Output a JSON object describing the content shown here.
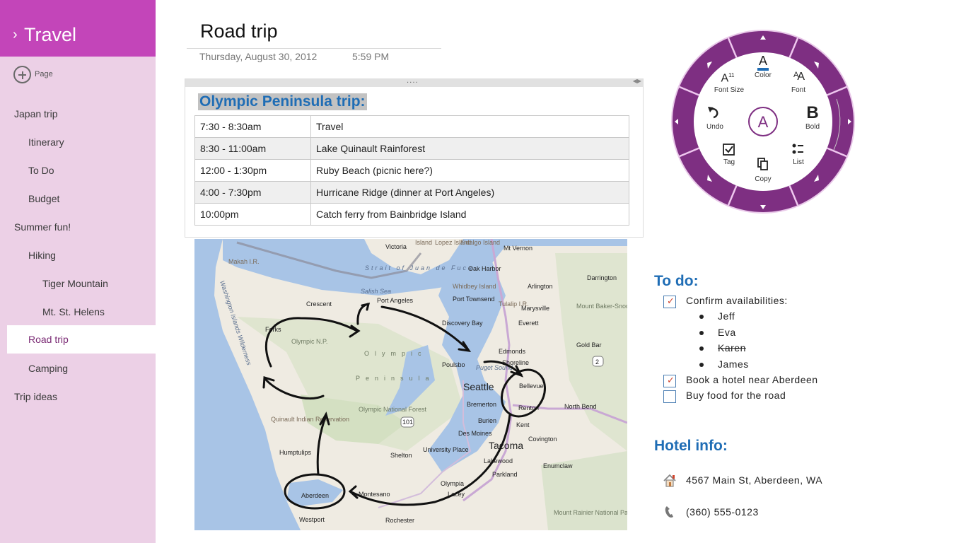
{
  "notebook": {
    "title": "Travel",
    "chevron_icon": "chevron-right-icon",
    "add_page_label": "Page"
  },
  "sidebar": {
    "pages": [
      {
        "label": "Japan trip",
        "level": 0,
        "selected": false
      },
      {
        "label": "Itinerary",
        "level": 1,
        "selected": false
      },
      {
        "label": "To Do",
        "level": 1,
        "selected": false
      },
      {
        "label": "Budget",
        "level": 1,
        "selected": false
      },
      {
        "label": "Summer fun!",
        "level": 0,
        "selected": false
      },
      {
        "label": "Hiking",
        "level": 1,
        "selected": false
      },
      {
        "label": "Tiger Mountain",
        "level": 2,
        "selected": false
      },
      {
        "label": "Mt. St. Helens",
        "level": 2,
        "selected": false
      },
      {
        "label": "Road trip",
        "level": 1,
        "selected": true
      },
      {
        "label": "Camping",
        "level": 1,
        "selected": false
      },
      {
        "label": "Trip ideas",
        "level": 0,
        "selected": false
      }
    ]
  },
  "page": {
    "title": "Road trip",
    "date": "Thursday, August 30, 2012",
    "time": "5:59 PM"
  },
  "note": {
    "grip": "....",
    "heading": "Olympic Peninsula trip:",
    "schedule": [
      {
        "time": "7:30 - 8:30am",
        "activity": "Travel"
      },
      {
        "time": "8:30 - 11:00am",
        "activity": "Lake Quinault Rainforest"
      },
      {
        "time": "12:00 - 1:30pm",
        "activity": "Ruby Beach (picnic here?)"
      },
      {
        "time": "4:00 - 7:30pm",
        "activity": "Hurricane Ridge (dinner at Port Angeles)"
      },
      {
        "time": "10:00pm",
        "activity": "Catch ferry from Bainbridge Island"
      }
    ]
  },
  "map": {
    "labels": {
      "victoria": "Victoria",
      "island": "Island",
      "lopez_island": "Lopez Island",
      "fidalgo_island": "Fidalgo Island",
      "mt_vernon": "Mt Vernon",
      "makah": "Makah I.R.",
      "strait": "Strait of Juan de Fuca",
      "oak_harbor": "Oak Harbor",
      "darrington": "Darrington",
      "whidbey": "Whidbey Island",
      "arlington": "Arlington",
      "salish_sea": "Salish Sea",
      "port_angeles": "Port Angeles",
      "port_townsend": "Port Townsend",
      "tulalip": "Tulalip I.R.",
      "marysville": "Marysville",
      "crescent": "Crescent",
      "mt_baker": "Mount Baker-Snoqualmie National Forest",
      "wilderness": "Washington Islands Wilderness",
      "discovery_bay": "Discovery Bay",
      "everett": "Everett",
      "forks": "Forks",
      "olympic_np": "Olympic N.P.",
      "gold_bar": "Gold Bar",
      "edmonds": "Edmonds",
      "olympic": "Olympic",
      "poulsbo": "Poulsbo",
      "shoreline": "Shoreline",
      "puget_sound": "Puget Sound",
      "hwy2": "2",
      "peninsula": "Peninsula",
      "seattle": "Seattle",
      "bellevue": "Bellevue",
      "bremerton": "Bremerton",
      "renton": "Renton",
      "north_bend": "North Bend",
      "olympic_nf": "Olympic National Forest",
      "quinault": "Quinault Indian Reservation",
      "hwy101": "101",
      "burien": "Burien",
      "kent": "Kent",
      "des_moines": "Des Moines",
      "covington": "Covington",
      "humptulips": "Humptulips",
      "shelton": "Shelton",
      "university_place": "University Place",
      "tacoma": "Tacoma",
      "lakewood": "Lakewood",
      "enumclaw": "Enumclaw",
      "parkland": "Parkland",
      "olympia": "Olympia",
      "montesano": "Montesano",
      "aberdeen": "Aberdeen",
      "lacey": "Lacey",
      "mt_rainier": "Mount Rainier National Park",
      "westport": "Westport",
      "rochester": "Rochester"
    }
  },
  "radial_menu": {
    "center_label": "A",
    "items": [
      {
        "id": "color",
        "label": "Color",
        "icon": "font-color-icon",
        "glyph": "A",
        "accent": "#1f6db5"
      },
      {
        "id": "font",
        "label": "Font",
        "icon": "font-icon",
        "glyph": "AA"
      },
      {
        "id": "bold",
        "label": "Bold",
        "icon": "bold-icon",
        "glyph": "B"
      },
      {
        "id": "list",
        "label": "List",
        "icon": "list-icon",
        "glyph": "list"
      },
      {
        "id": "copy",
        "label": "Copy",
        "icon": "copy-icon",
        "glyph": "copy"
      },
      {
        "id": "tag",
        "label": "Tag",
        "icon": "tag-checkbox-icon",
        "glyph": "tag"
      },
      {
        "id": "undo",
        "label": "Undo",
        "icon": "undo-icon",
        "glyph": "undo"
      },
      {
        "id": "font_size",
        "label": "Font Size",
        "icon": "font-size-icon",
        "glyph": "A",
        "size_value": "11"
      }
    ],
    "ring_color": "#7e2f82"
  },
  "todo": {
    "heading": "To do:",
    "items": [
      {
        "label": "Confirm availabilities:",
        "checked": true
      },
      {
        "label": "Book a hotel near Aberdeen",
        "checked": true
      },
      {
        "label": "Buy food for the road",
        "checked": false
      }
    ],
    "people": [
      {
        "name": "Jeff",
        "struck": false
      },
      {
        "name": "Eva",
        "struck": false
      },
      {
        "name": "Karen",
        "struck": true
      },
      {
        "name": "James",
        "struck": false
      }
    ]
  },
  "hotel": {
    "heading": "Hotel info:",
    "address": "4567 Main St, Aberdeen, WA",
    "address_icon": "home-icon",
    "phone": "(360) 555-0123",
    "phone_icon": "phone-icon"
  },
  "colors": {
    "notebook_header": "#c345b9",
    "sidebar_bg": "#ecd0e6",
    "heading_blue": "#1f6db5",
    "check_red": "#d0452e"
  }
}
